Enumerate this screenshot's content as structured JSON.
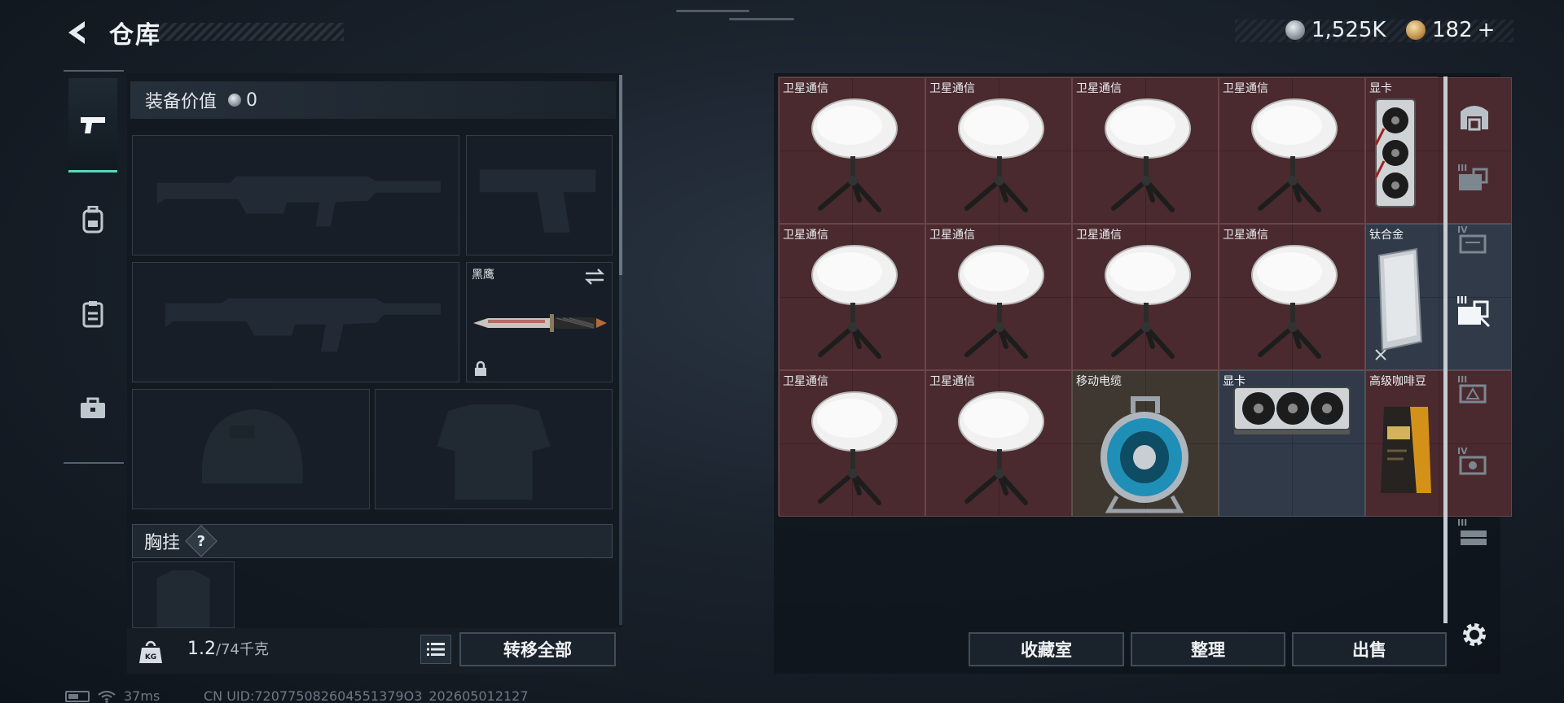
{
  "header": {
    "title": "仓库",
    "currency_silver": "1,525K",
    "currency_gold": "182",
    "gold_plus": "+"
  },
  "loadout": {
    "value_label": "装备价值",
    "value_amount": "0",
    "melee_slot_name": "黑鹰",
    "chest_rig_label": "胸挂",
    "help_glyph": "?",
    "weight_current": "1.2",
    "weight_capacity": "/74千克",
    "transfer_all_label": "转移全部"
  },
  "stash": {
    "items": [
      {
        "name": "卫星通信",
        "type": "dish"
      },
      {
        "name": "卫星通信",
        "type": "dish"
      },
      {
        "name": "卫星通信",
        "type": "dish"
      },
      {
        "name": "卫星通信",
        "type": "dish"
      },
      {
        "name": "显卡",
        "type": "gpu-vertical"
      },
      {
        "name": "卫星通信",
        "type": "dish"
      },
      {
        "name": "卫星通信",
        "type": "dish"
      },
      {
        "name": "卫星通信",
        "type": "dish"
      },
      {
        "name": "卫星通信",
        "type": "dish"
      },
      {
        "name": "钛合金",
        "type": "ingot"
      },
      {
        "name": "卫星通信",
        "type": "dish"
      },
      {
        "name": "卫星通信",
        "type": "dish"
      },
      {
        "name": "移动电缆",
        "type": "cable-reel"
      },
      {
        "name": "显卡",
        "type": "gpu-stack",
        "second_name": "显卡"
      },
      {
        "name": "高级咖啡豆",
        "type": "coffee"
      }
    ],
    "collection_label": "收藏室",
    "sort_label": "整理",
    "sell_label": "出售"
  },
  "status": {
    "ping": "37ms",
    "uid": "CN UID:720775082604551379O3_202605012127"
  },
  "colors": {
    "accent": "#59d7bf",
    "rare_bg": "#4a2a2e"
  }
}
